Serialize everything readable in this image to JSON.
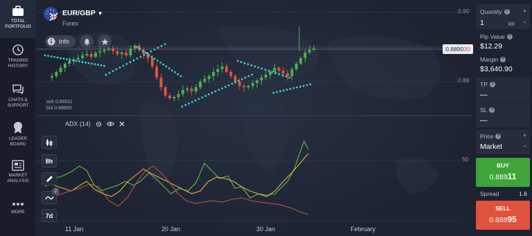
{
  "sidebar": {
    "items": [
      {
        "label1": "TOTAL",
        "label2": "PORTFOLIO",
        "icon": "briefcase-icon"
      },
      {
        "label1": "TRADING",
        "label2": "HISTORY",
        "icon": "history-icon"
      },
      {
        "label1": "CHATS &",
        "label2": "SUPPORT",
        "icon": "chat-icon"
      },
      {
        "label1": "LEADER",
        "label2": "BOARD",
        "icon": "award-icon"
      },
      {
        "label1": "MARKET",
        "label2": "ANALYSIS",
        "icon": "news-icon"
      },
      {
        "label1": "MORE",
        "label2": "",
        "icon": "more-icon"
      }
    ]
  },
  "asset": {
    "name": "EUR/GBP",
    "type": "Forex",
    "info_label": "Info"
  },
  "quotes": {
    "ask": "ask 0.88911",
    "bid": "bid 0.88895"
  },
  "indicator": {
    "name": "ADX (14)"
  },
  "tools": {
    "timeframe": "8h",
    "period": "7d",
    "indicator_count": "2"
  },
  "axis": {
    "dates": [
      "11 Jan",
      "20 Jan",
      "30 Jan",
      "February"
    ],
    "price_ticks": [
      "0.90",
      "0.88"
    ],
    "adx_tick": "50"
  },
  "current_price": {
    "main": "0.8890",
    "highlight": "30"
  },
  "panel": {
    "quantity_label": "Quantity",
    "quantity_value": "1",
    "quantity_unit": "lot",
    "pip_label": "Pip Value",
    "pip_value": "$12.29",
    "margin_label": "Margin",
    "margin_value": "$3,640.90",
    "tp_label": "TP",
    "tp_value": "—",
    "sl_label": "SL",
    "sl_value": "—",
    "price_label": "Price",
    "price_value": "Market",
    "buy_label": "BUY",
    "buy_price_main": "0.889",
    "buy_price_big": "11",
    "spread_label": "Spread",
    "spread_value": "1.6",
    "sell_label": "SELL",
    "sell_price_main": "0.888",
    "sell_price_big": "95"
  },
  "colors": {
    "bull": "#4caf50",
    "bear": "#e0523d",
    "sar": "#3fd0d8",
    "adx_green": "#5fbf45",
    "adx_red": "#c8553a",
    "adx_orange": "#e3b04b",
    "buy": "#3fa53a",
    "sell": "#e0523d"
  }
}
